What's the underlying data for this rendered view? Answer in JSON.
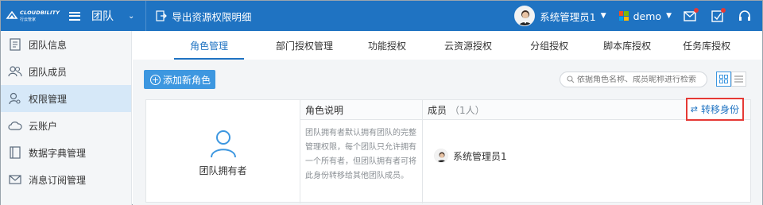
{
  "brand": {
    "name": "CLOUDBILITY",
    "subtitle": "行云管家"
  },
  "header": {
    "team_title": "团队",
    "export_label": "导出资源权限明细",
    "user_name": "系统管理员1",
    "org_name": "demo",
    "colors": {
      "bar": "#1f73c2",
      "ms_red": "#f25022",
      "ms_green": "#7fba00",
      "ms_blue": "#00a4ef",
      "ms_yellow": "#ffb900"
    }
  },
  "sidebar": {
    "items": [
      {
        "label": "团队信息",
        "icon": "document-icon"
      },
      {
        "label": "团队成员",
        "icon": "users-icon"
      },
      {
        "label": "权限管理",
        "icon": "user-key-icon",
        "active": true
      },
      {
        "label": "云账户",
        "icon": "cloud-icon"
      },
      {
        "label": "数据字典管理",
        "icon": "book-icon"
      },
      {
        "label": "消息订阅管理",
        "icon": "mail-icon"
      }
    ]
  },
  "tabs": [
    {
      "label": "角色管理",
      "active": true
    },
    {
      "label": "部门授权管理"
    },
    {
      "label": "功能授权"
    },
    {
      "label": "云资源授权"
    },
    {
      "label": "分组授权"
    },
    {
      "label": "脚本库授权"
    },
    {
      "label": "任务库授权"
    }
  ],
  "toolbar": {
    "add_role_label": "添加新角色",
    "search_placeholder": "依据角色名称、成员昵称进行检索"
  },
  "role": {
    "name": "团队拥有者",
    "desc_header": "角色说明",
    "description": "团队拥有者默认拥有团队的完整管理权限，每个团队只允许拥有一个所有者，但团队拥有者可将此身份转移给其他团队成员。",
    "members_header": "成员",
    "members_count": "（1人）",
    "transfer_label": "转移身份",
    "members": [
      {
        "name": "系统管理员1"
      }
    ]
  }
}
